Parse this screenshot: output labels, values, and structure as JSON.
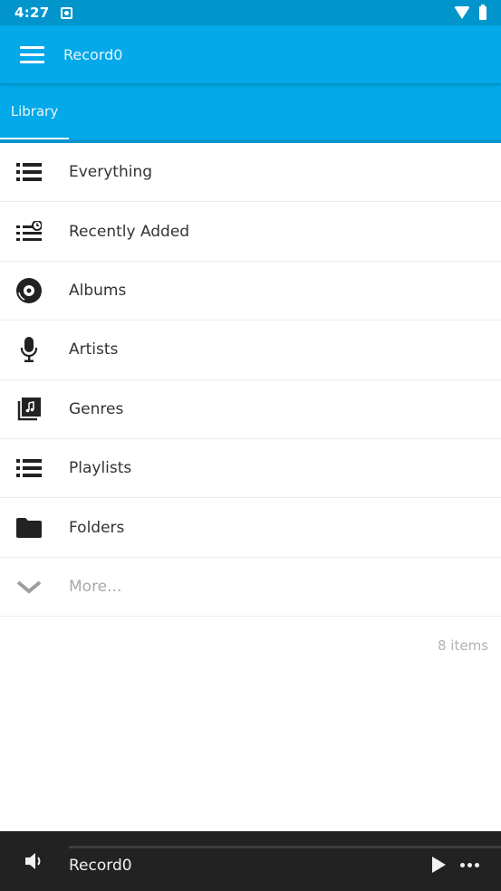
{
  "status_bar": {
    "time": "4:27"
  },
  "app_bar": {
    "title": "Record0",
    "menu_icon": "hamburger-menu-icon"
  },
  "tabs": [
    {
      "label": "Library",
      "selected": true
    }
  ],
  "library": {
    "items": [
      {
        "label": "Everything",
        "icon": "list-icon",
        "muted": false
      },
      {
        "label": "Recently Added",
        "icon": "recently-added-icon",
        "muted": false
      },
      {
        "label": "Albums",
        "icon": "album-disc-icon",
        "muted": false
      },
      {
        "label": "Artists",
        "icon": "microphone-icon",
        "muted": false
      },
      {
        "label": "Genres",
        "icon": "genre-music-icon",
        "muted": false
      },
      {
        "label": "Playlists",
        "icon": "playlist-icon",
        "muted": false
      },
      {
        "label": "Folders",
        "icon": "folder-icon",
        "muted": false
      },
      {
        "label": "More...",
        "icon": "chevron-down-icon",
        "muted": true
      }
    ],
    "count_label": "8 items"
  },
  "player": {
    "track_title": "Record0",
    "volume_icon": "volume-icon",
    "play_icon": "play-icon",
    "more_icon": "more-horizontal-icon"
  },
  "colors": {
    "status_bar": "#0295cc",
    "app_bar": "#03a9e8",
    "player_bar": "#222222",
    "list_text": "#333333",
    "muted_text": "#a8a8a8"
  }
}
